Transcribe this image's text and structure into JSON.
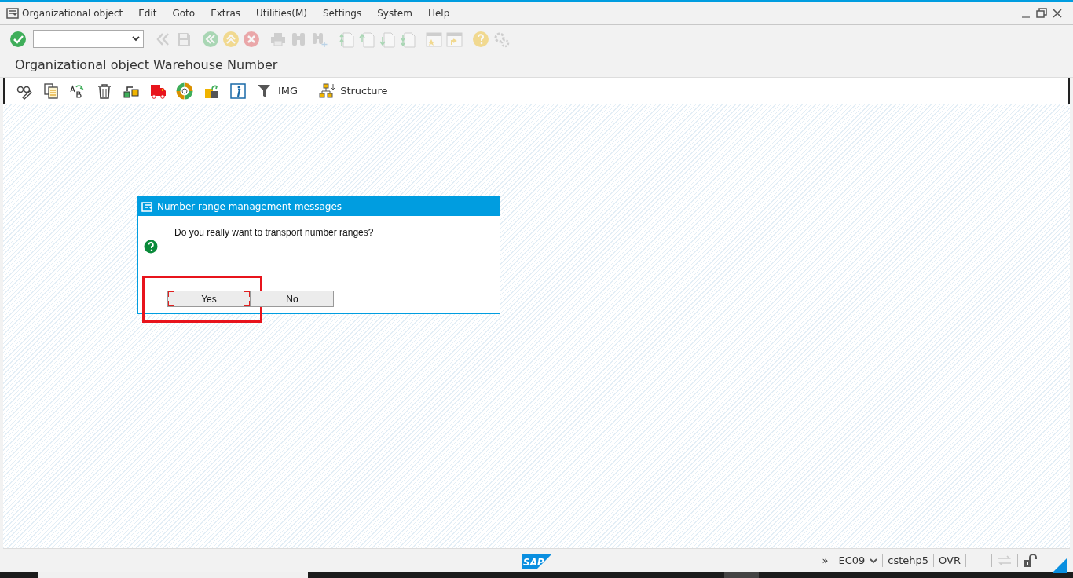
{
  "menu_bar": {
    "items": [
      {
        "label": "Organizational object"
      },
      {
        "label": "Edit"
      },
      {
        "label": "Goto"
      },
      {
        "label": "Extras"
      },
      {
        "label": "Utilities(M)"
      },
      {
        "label": "Settings"
      },
      {
        "label": "System"
      },
      {
        "label": "Help"
      }
    ]
  },
  "system_toolbar": {
    "items": [
      {
        "kind": "enter",
        "disabled": false
      },
      {
        "kind": "command-field"
      },
      {
        "kind": "double-back",
        "disabled": true
      },
      {
        "kind": "save",
        "disabled": true
      },
      {
        "kind": "back",
        "disabled": true
      },
      {
        "kind": "exit",
        "disabled": true
      },
      {
        "kind": "cancel",
        "disabled": true
      },
      {
        "kind": "print",
        "disabled": true
      },
      {
        "kind": "find",
        "disabled": true
      },
      {
        "kind": "find-next",
        "disabled": true
      },
      {
        "kind": "first-page",
        "disabled": true
      },
      {
        "kind": "prev-page",
        "disabled": true
      },
      {
        "kind": "next-page",
        "disabled": true
      },
      {
        "kind": "last-page",
        "disabled": true
      },
      {
        "kind": "new-window",
        "disabled": true
      },
      {
        "kind": "shortcut",
        "disabled": true
      },
      {
        "kind": "help",
        "disabled": true
      },
      {
        "kind": "customize",
        "disabled": true
      }
    ]
  },
  "window": {
    "title": "Organizational object Warehouse Number"
  },
  "app_toolbar": {
    "items": [
      {
        "kind": "display-change"
      },
      {
        "kind": "copy"
      },
      {
        "kind": "rename"
      },
      {
        "kind": "delete"
      },
      {
        "kind": "transfer"
      },
      {
        "kind": "truck"
      },
      {
        "kind": "ring"
      },
      {
        "kind": "export"
      },
      {
        "kind": "info"
      },
      {
        "kind": "filter",
        "label": "IMG"
      },
      {
        "kind": "hierarchy",
        "label": "Structure"
      }
    ]
  },
  "dialog": {
    "title": "Number range management messages",
    "message": "Do you really want to transport number ranges?",
    "buttons": [
      {
        "label": "Yes",
        "focused": true,
        "annotated": true
      },
      {
        "label": "No",
        "focused": false,
        "annotated": false
      }
    ]
  },
  "status_bar": {
    "logo": "SAP",
    "expand": "»",
    "system": "EC09",
    "client": "cstehp5",
    "mode": "OVR"
  }
}
